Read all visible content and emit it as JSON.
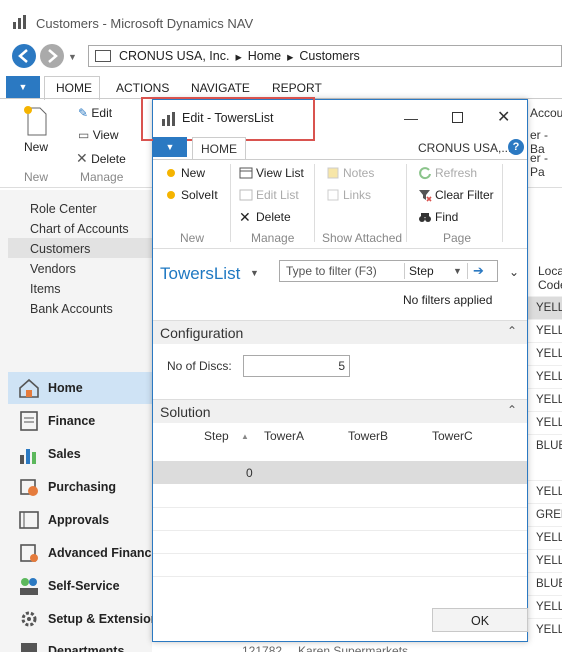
{
  "main_window": {
    "title": "Customers - Microsoft Dynamics NAV",
    "breadcrumb": [
      "CRONUS USA, Inc.",
      "Home",
      "Customers"
    ],
    "ribbon_tabs": [
      "HOME",
      "ACTIONS",
      "NAVIGATE",
      "REPORT"
    ],
    "ribbon": {
      "new_label": "New",
      "edit_label": "Edit",
      "view_label": "View",
      "delete_label": "Delete",
      "groups": [
        "New",
        "Manage"
      ]
    },
    "nav_links": [
      "Role Center",
      "Chart of Accounts",
      "Customers",
      "Vendors",
      "Items",
      "Bank Accounts"
    ],
    "nav_sections": [
      "Home",
      "Finance",
      "Sales",
      "Purchasing",
      "Approvals",
      "Advanced Finance",
      "Self-Service",
      "Setup & Extension",
      "Departments"
    ],
    "bottom_row": {
      "number": "121782",
      "name": "Karen Supermarkets"
    },
    "right_list": {
      "header_top": "Accoun",
      "header_line2": "er - Ba",
      "header_line3": "er - Pa",
      "col_header": "Loca",
      "col_header2": "Code",
      "cells": [
        "YELLO",
        "YELLO",
        "YELLO",
        "YELLO",
        "YELLO",
        "YELLO",
        "BLUE",
        "YELLO",
        "GREE",
        "YELLO",
        "YELLO",
        "BLUE",
        "YELLO",
        "YELLO"
      ]
    }
  },
  "dialog": {
    "title": "Edit - TowersList",
    "company": "CRONUS USA,...",
    "tab": "HOME",
    "ribbon": {
      "new_label": "New",
      "solveit_label": "SolveIt",
      "viewlist_label": "View List",
      "editlist_label": "Edit List",
      "delete_label": "Delete",
      "notes_label": "Notes",
      "links_label": "Links",
      "refresh_label": "Refresh",
      "clearfilter_label": "Clear Filter",
      "find_label": "Find",
      "groups": [
        "New",
        "Manage",
        "Show Attached",
        "Page"
      ]
    },
    "page_caption": "TowersList",
    "filter": {
      "placeholder": "Type to filter (F3)",
      "field": "Step"
    },
    "no_filters": "No filters applied",
    "configuration": {
      "title": "Configuration",
      "no_of_discs_label": "No of Discs:",
      "no_of_discs_value": "5"
    },
    "solution": {
      "title": "Solution",
      "columns": [
        "Step",
        "TowerA",
        "TowerB",
        "TowerC"
      ],
      "rows": [
        {
          "step": "0"
        }
      ]
    },
    "ok_label": "OK"
  },
  "colors": {
    "accent": "#1e78c2",
    "highlight_box": "#d9534f",
    "selected_row": "#dcdcdc"
  }
}
